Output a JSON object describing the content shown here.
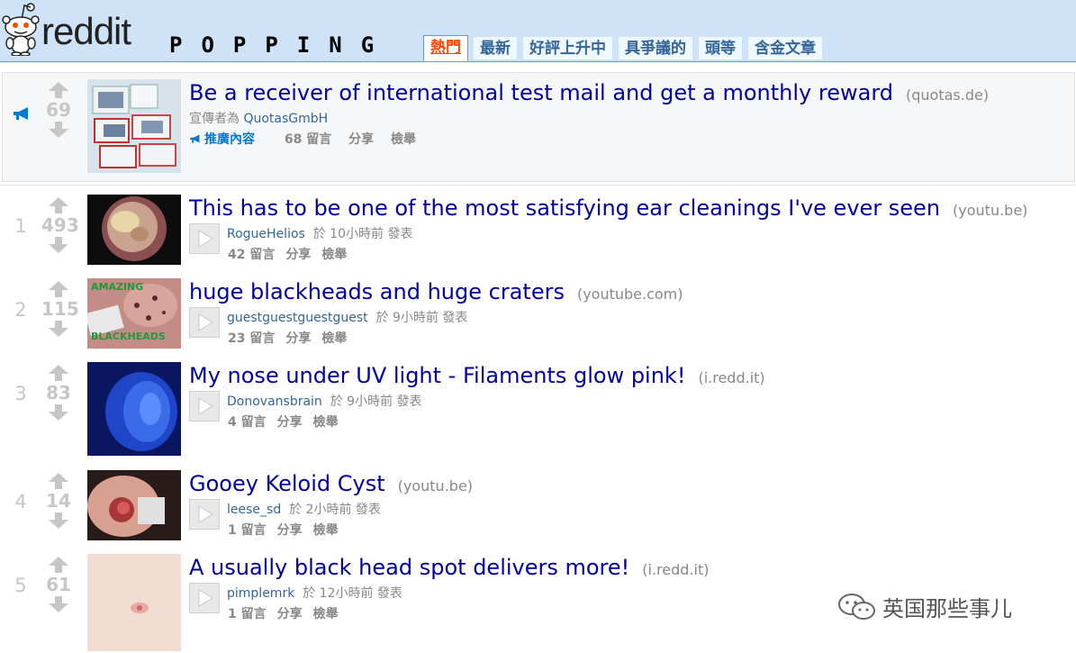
{
  "header": {
    "logo_text": "reddit",
    "subreddit": "POPPING",
    "tabs": [
      {
        "label": "熱門",
        "selected": true
      },
      {
        "label": "最新"
      },
      {
        "label": "好評上升中"
      },
      {
        "label": "具爭議的"
      },
      {
        "label": "頭等"
      },
      {
        "label": "含金文章"
      }
    ]
  },
  "promoted": {
    "score": "69",
    "title": "Be a receiver of international test mail and get a monthly reward",
    "domain": "(quotas.de)",
    "tagline_prefix": "宣傳者為",
    "author": "QuotasGmbH",
    "label": "推廣內容",
    "comments": "68 留言",
    "share": "分享",
    "report": "檢舉"
  },
  "posts": [
    {
      "rank": "1",
      "score": "493",
      "title": "This has to be one of the most satisfying ear cleanings I've ever seen",
      "domain": "(youtu.be)",
      "author": "RogueHelios",
      "time": "於 10小時前 發表",
      "comments": "42 留言",
      "share": "分享",
      "report": "檢舉"
    },
    {
      "rank": "2",
      "score": "115",
      "title": "huge blackheads and huge craters",
      "domain": "(youtube.com)",
      "author": "guestguestguestguest",
      "time": "於 9小時前 發表",
      "comments": "23 留言",
      "share": "分享",
      "report": "檢舉",
      "thumb_text_top": "AMAZING",
      "thumb_text_bottom": "BLACKHEADS"
    },
    {
      "rank": "3",
      "score": "83",
      "title": "My nose under UV light - Filaments glow pink!",
      "domain": "(i.redd.it)",
      "author": "Donovansbrain",
      "time": "於 9小時前 發表",
      "comments": "4 留言",
      "share": "分享",
      "report": "檢舉"
    },
    {
      "rank": "4",
      "score": "14",
      "title": "Gooey Keloid Cyst",
      "domain": "(youtu.be)",
      "author": "leese_sd",
      "time": "於 2小時前 發表",
      "comments": "1 留言",
      "share": "分享",
      "report": "檢舉"
    },
    {
      "rank": "5",
      "score": "61",
      "title": "A usually black head spot delivers more!",
      "domain": "(i.redd.it)",
      "author": "pimplemrk",
      "time": "於 12小時前 發表",
      "comments": "1 留言",
      "share": "分享",
      "report": "檢舉"
    }
  ],
  "watermark": "英国那些事儿",
  "colors": {
    "header_bg": "#cee3f8",
    "title": "#0000a3",
    "selected_tab": "#ff4500",
    "link": "#369"
  }
}
